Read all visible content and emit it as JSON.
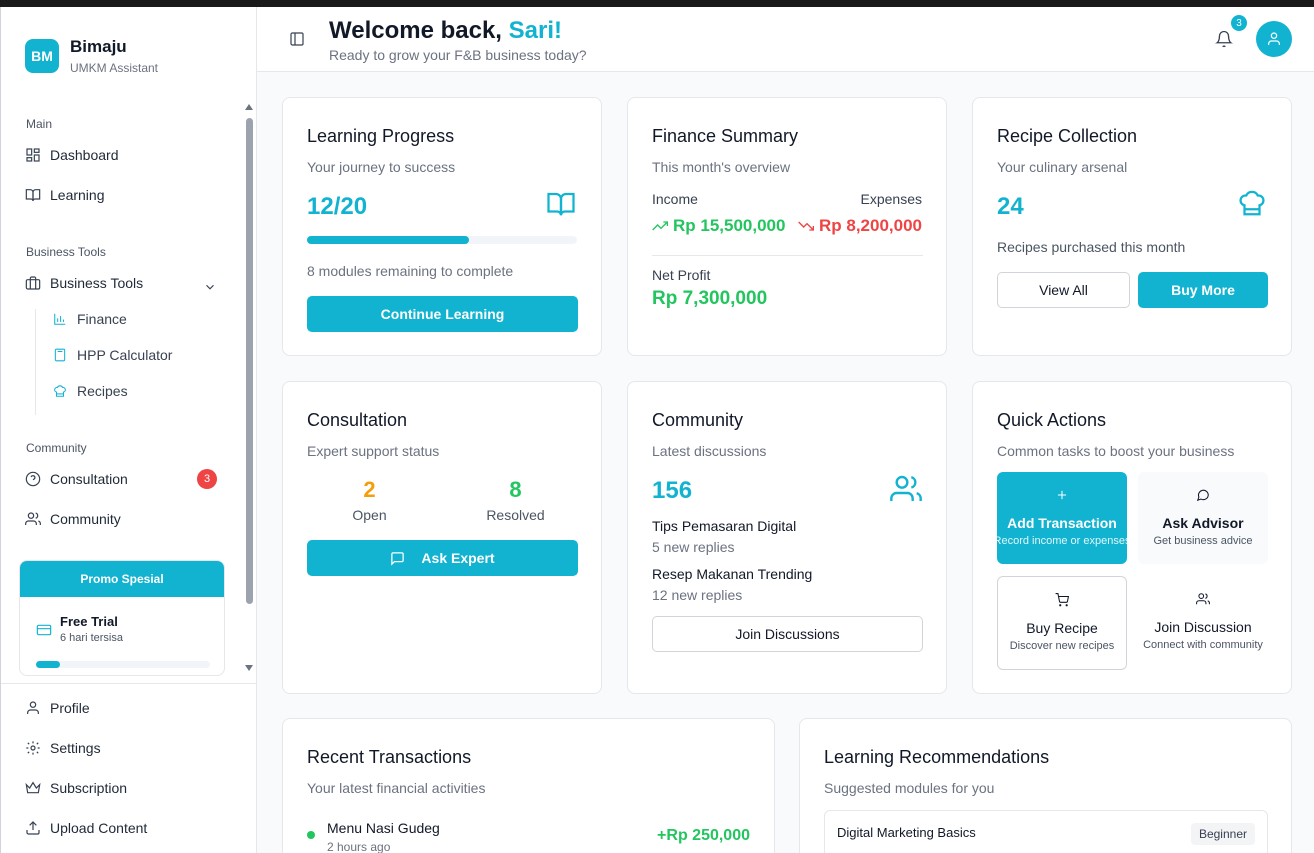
{
  "sidebar": {
    "brand": {
      "logo": "BM",
      "name": "Bimaju",
      "subtitle": "UMKM Assistant"
    },
    "sections": {
      "main": "Main",
      "business": "Business Tools",
      "community": "Community"
    },
    "items": {
      "dashboard": "Dashboard",
      "learning": "Learning",
      "business_tools": "Business Tools",
      "finance": "Finance",
      "hpp": "HPP Calculator",
      "recipes": "Recipes",
      "consultation": "Consultation",
      "consultation_badge": "3",
      "community": "Community",
      "profile": "Profile",
      "settings": "Settings",
      "subscription": "Subscription",
      "upload": "Upload Content"
    },
    "promo": {
      "header": "Promo Spesial",
      "title": "Free Trial",
      "subtitle": "6 hari tersisa",
      "progress": 0.14
    }
  },
  "header": {
    "welcome": "Welcome back, ",
    "name": "Sari!",
    "subtitle": "Ready to grow your F&B business today?",
    "notification_count": "3"
  },
  "learning_progress": {
    "title": "Learning Progress",
    "subtitle": "Your journey to success",
    "value": "12/20",
    "progress": 0.6,
    "remaining": "8 modules remaining to complete",
    "button": "Continue Learning"
  },
  "finance_summary": {
    "title": "Finance Summary",
    "subtitle": "This month's overview",
    "income_label": "Income",
    "expenses_label": "Expenses",
    "income": "Rp 15,500,000",
    "expenses": "Rp 8,200,000",
    "net_label": "Net Profit",
    "net": "Rp 7,300,000"
  },
  "recipe_collection": {
    "title": "Recipe Collection",
    "subtitle": "Your culinary arsenal",
    "value": "24",
    "note": "Recipes purchased this month",
    "view_all": "View All",
    "buy_more": "Buy More"
  },
  "consultation": {
    "title": "Consultation",
    "subtitle": "Expert support status",
    "open_value": "2",
    "open_label": "Open",
    "resolved_value": "8",
    "resolved_label": "Resolved",
    "button": "Ask Expert"
  },
  "community": {
    "title": "Community",
    "subtitle": "Latest discussions",
    "value": "156",
    "topics": [
      {
        "title": "Tips Pemasaran Digital",
        "replies": "5 new replies"
      },
      {
        "title": "Resep Makanan Trending",
        "replies": "12 new replies"
      }
    ],
    "button": "Join Discussions"
  },
  "quick_actions": {
    "title": "Quick Actions",
    "subtitle": "Common tasks to boost your business",
    "actions": [
      {
        "label": "Add Transaction",
        "desc": "Record income or expenses"
      },
      {
        "label": "Ask Advisor",
        "desc": "Get business advice"
      },
      {
        "label": "Buy Recipe",
        "desc": "Discover new recipes"
      },
      {
        "label": "Join Discussion",
        "desc": "Connect with community"
      }
    ]
  },
  "recent_transactions": {
    "title": "Recent Transactions",
    "subtitle": "Your latest financial activities",
    "items": [
      {
        "name": "Menu Nasi Gudeg",
        "time": "2 hours ago",
        "amount": "+Rp 250,000"
      }
    ]
  },
  "learning_recommendations": {
    "title": "Learning Recommendations",
    "subtitle": "Suggested modules for you",
    "items": [
      {
        "title": "Digital Marketing Basics",
        "level": "Beginner"
      }
    ]
  },
  "colors": {
    "accent": "#12b3d0",
    "positive": "#22c55e",
    "negative": "#ef4444",
    "warning": "#f59e0b"
  },
  "icons": [
    "dashboard-icon",
    "book-icon",
    "briefcase-icon",
    "chart-icon",
    "calculator-icon",
    "chef-hat-icon",
    "help-circle-icon",
    "users-icon",
    "card-icon",
    "user-icon",
    "gear-icon",
    "crown-icon",
    "upload-icon",
    "sidebar-toggle-icon",
    "bell-icon",
    "trend-up-icon",
    "trend-down-icon",
    "message-icon",
    "plus-icon",
    "cart-icon"
  ]
}
